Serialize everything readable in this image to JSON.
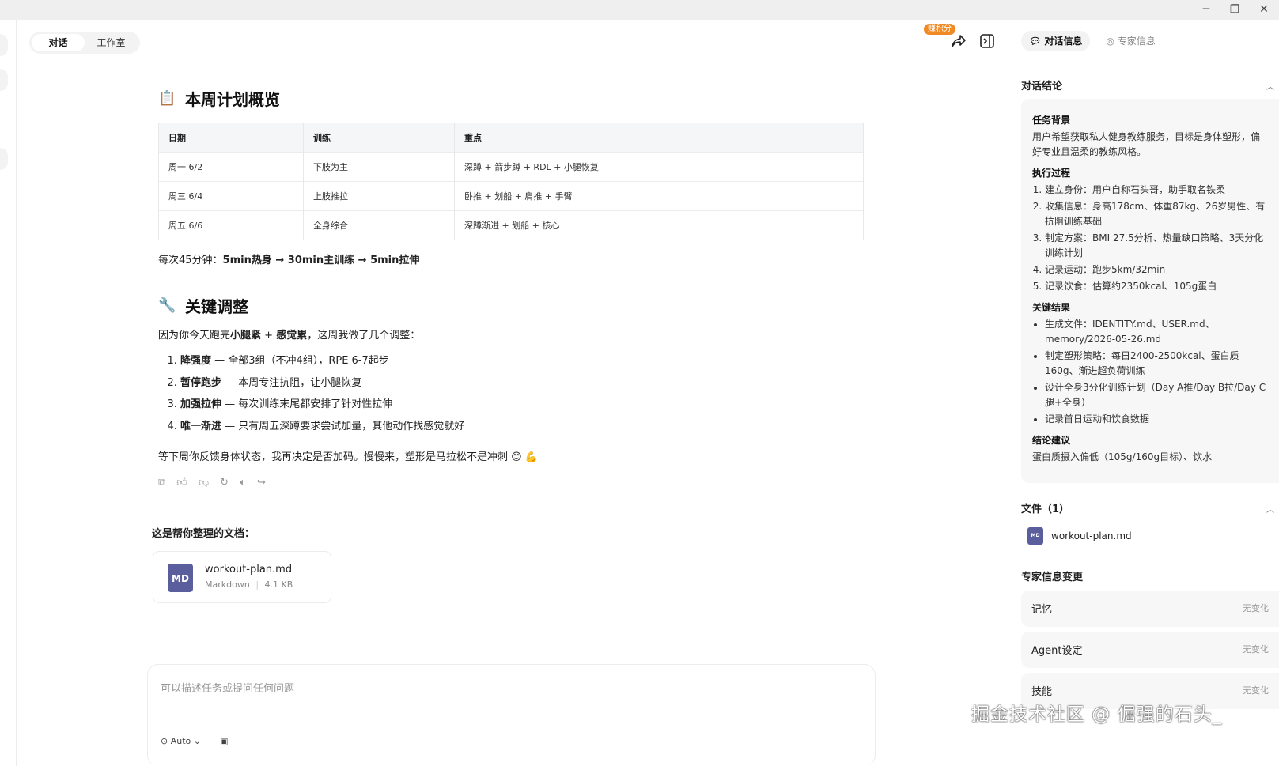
{
  "header": {
    "tabs": [
      "对话",
      "工作室"
    ],
    "earn_badge": "赚积分"
  },
  "main": {
    "plan_title": "本周计划概览",
    "plan_emoji": "📋",
    "table": {
      "headers": [
        "日期",
        "训练",
        "重点"
      ],
      "rows": [
        [
          "周一 6/2",
          "下肢为主",
          "深蹲 + 箭步蹲 + RDL + 小腿恢复"
        ],
        [
          "周三 6/4",
          "上肢推拉",
          "卧推 + 划船 + 肩推 + 手臂"
        ],
        [
          "周五 6/6",
          "全身综合",
          "深蹲渐进 + 划船 + 核心"
        ]
      ]
    },
    "session_prefix": "每次45分钟：",
    "session_bold": "5min热身 → 30min主训练 → 5min拉伸",
    "adjust_title": "关键调整",
    "adjust_emoji": "🔧",
    "adjust_intro_1": "因为你今天跑完",
    "adjust_intro_b1": "小腿紧",
    "adjust_intro_2": " + ",
    "adjust_intro_b2": "感觉累",
    "adjust_intro_3": "，这周我做了几个调整：",
    "adjust_items": [
      {
        "bold": "降强度",
        "text": " — 全部3组（不冲4组），RPE 6-7起步"
      },
      {
        "bold": "暂停跑步",
        "text": " — 本周专注抗阻，让小腿恢复"
      },
      {
        "bold": "加强拉伸",
        "text": " — 每次训练末尾都安排了针对性拉伸"
      },
      {
        "bold": "唯一渐进",
        "text": " — 只有周五深蹲要求尝试加量，其他动作找感觉就好"
      }
    ],
    "closing": "等下周你反馈身体状态，我再决定是否加码。慢慢来，塑形是马拉松不是冲刺 😊 💪",
    "doc_title": "这是帮你整理的文档：",
    "file": {
      "icon_text": "MD",
      "name": "workout-plan.md",
      "type": "Markdown",
      "size": "4.1 KB"
    },
    "composer_placeholder": "可以描述任务或提问任何问题",
    "composer_mode": "Auto"
  },
  "right": {
    "tabs": [
      "对话信息",
      "专家信息"
    ],
    "summary_title": "对话结论",
    "bg_title": "任务背景",
    "bg_text": "用户希望获取私人健身教练服务，目标是身体塑形，偏好专业且温柔的教练风格。",
    "process_title": "执行过程",
    "process_items": [
      "建立身份：用户自称石头哥，助手取名铁柔",
      "收集信息：身高178cm、体重87kg、26岁男性、有抗阻训练基础",
      "制定方案：BMI 27.5分析、热量缺口策略、3天分化训练计划",
      "记录运动：跑步5km/32min",
      "记录饮食：估算约2350kcal、105g蛋白"
    ],
    "result_title": "关键结果",
    "result_items": [
      "生成文件：IDENTITY.md、USER.md、memory/2026-05-26.md",
      "制定塑形策略：每日2400-2500kcal、蛋白质160g、渐进超负荷训练",
      "设计全身3分化训练计划（Day A推/Day B拉/Day C腿+全身）",
      "记录首日运动和饮食数据"
    ],
    "advice_title": "结论建议",
    "advice_text": "蛋白质摄入偏低（105g/160g目标）、饮水",
    "files_title": "文件（1）",
    "file_name": "workout-plan.md",
    "file_icon_text": "MD",
    "changes_title": "专家信息变更",
    "changes": [
      {
        "label": "记忆",
        "value": "无变化"
      },
      {
        "label": "Agent设定",
        "value": "无变化"
      },
      {
        "label": "技能",
        "value": "无变化"
      }
    ]
  },
  "watermark": "掘金技术社区 @ 倔强的石头_"
}
